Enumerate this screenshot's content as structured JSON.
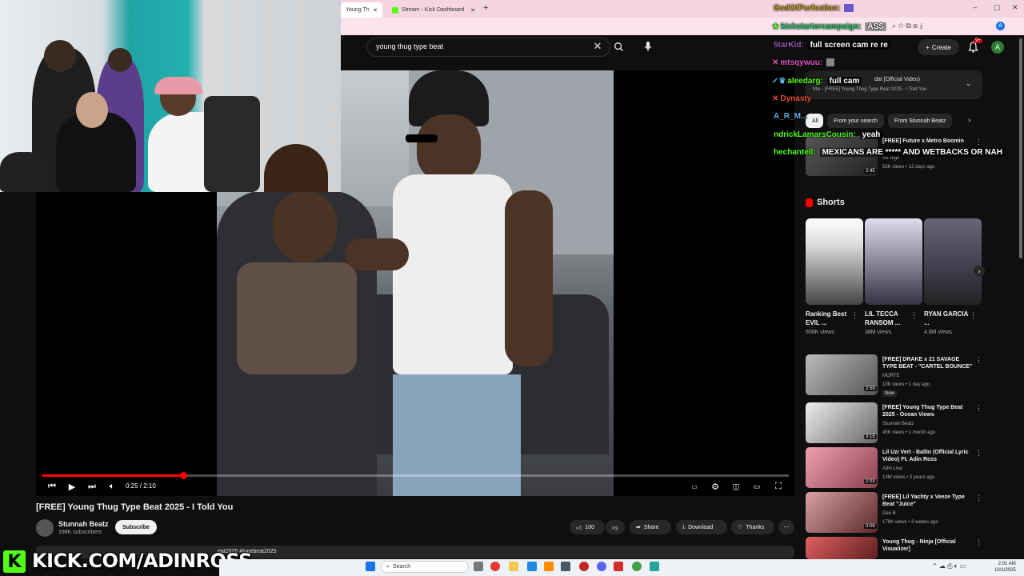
{
  "browser": {
    "tabs": [
      {
        "label": "Young Thug Ty"
      },
      {
        "label": "Stream - Kick Dashboard"
      }
    ]
  },
  "search": {
    "value": "young thug type beat"
  },
  "header": {
    "create_label": "Create",
    "notif_count": "9+",
    "avatar_letter": "A"
  },
  "player": {
    "time": "0:25 / 2:10",
    "progress": 0.19
  },
  "video": {
    "title": "[FREE] Young Thug Type Beat 2025 - I Told You",
    "channel": "Stunnah Beatz",
    "subscribers": "198K subscribers",
    "subscribe_label": "Subscribe",
    "likes": "100",
    "share_label": "Share",
    "download_label": "Download",
    "thanks_label": "Thanks",
    "description_partial": "eat2025 #typebeat2025"
  },
  "mix": {
    "title": "dat [Official Video)",
    "subtitle": "Mix - [FREE] Young Thug Type Beat 2025 - I Told You"
  },
  "chips": [
    "All",
    "From your search",
    "From Stunnah Beatz"
  ],
  "rec_top": {
    "title": "[FREE] Future x Metro Boomin",
    "channel": "So High",
    "meta": "53K views • 12 days ago",
    "duration": "2:45"
  },
  "shorts": {
    "heading": "Shorts",
    "items": [
      {
        "title": "Ranking Best EVIL ...",
        "views": "658K views"
      },
      {
        "title": "LIL TECCA RANSOM ...",
        "views": "38M views"
      },
      {
        "title": "RYAN GARCIA ...",
        "views": "4.8M views"
      }
    ]
  },
  "recs": [
    {
      "title": "[FREE] DRAKE x 21 SAVAGE TYPE BEAT - \"CARTEL BOUNCE\"",
      "channel": "MORTE",
      "meta": "10K views • 1 day ago",
      "duration": "2:59",
      "badge": "New"
    },
    {
      "title": "[FREE] Young Thug Type Beat 2025 - Ocean Views",
      "channel": "Stunnah Beatz",
      "meta": "45K views • 1 month ago",
      "duration": "3:15"
    },
    {
      "title": "Lil Uzi Vert - Ballin (Official Lyric Video) Ft. Adin Ross",
      "channel": "Adin Live",
      "meta": "13M views • 3 years ago",
      "duration": "2:03"
    },
    {
      "title": "[FREE] Lil Yachty x Veeze Type Beat \"Juice\"",
      "channel": "Dee B",
      "meta": "178K views • 3 weeks ago",
      "duration": "3:06"
    },
    {
      "title": "Young Thug - Ninja [Official Visualizer]",
      "channel": "",
      "meta": "",
      "duration": ""
    }
  ],
  "chat": [
    {
      "user": "GodOfPerfection:",
      "msg": "",
      "user_color": "#c9a227"
    },
    {
      "user": "kickstartercampaign:",
      "msg": "ASS",
      "user_color": "#2ecc71"
    },
    {
      "user": "5tarKid:",
      "msg": "full screen cam re re",
      "user_color": "#9b59b6"
    },
    {
      "user": "mtsqywuu:",
      "msg": "",
      "user_color": "#e056c6"
    },
    {
      "user": "aleedarg:",
      "msg": "full cam",
      "user_color": "#53fc18"
    },
    {
      "user": "Dynasty",
      "msg": "",
      "user_color": "#e74c3c"
    },
    {
      "user": "A_R_M...",
      "msg": "",
      "user_color": "#5dade2"
    },
    {
      "user": "ndrickLamarsCousin:",
      "msg": "yeah",
      "user_color": "#53fc18"
    },
    {
      "user": "hechantell:",
      "msg": "MEXICANS ARE ***** AND WETBACKS OR NAH",
      "user_color": "#53fc18"
    }
  ],
  "kick": {
    "logo_letter": "K",
    "banner_text": "KICK.COM/ADINROSS"
  },
  "taskbar": {
    "search_placeholder": "Search",
    "time": "2:01 AM",
    "date": "10/1/2025"
  },
  "colors": {
    "accent_red": "#ff0000",
    "kick_green": "#53fc18",
    "bg": "#0f0f0f"
  },
  "icons": [
    "search-icon",
    "mic-icon",
    "bell-icon",
    "play-icon",
    "settings-icon",
    "fullscreen-icon",
    "like-icon",
    "dislike-icon",
    "share-icon",
    "download-icon",
    "thanks-icon",
    "more-icon"
  ]
}
